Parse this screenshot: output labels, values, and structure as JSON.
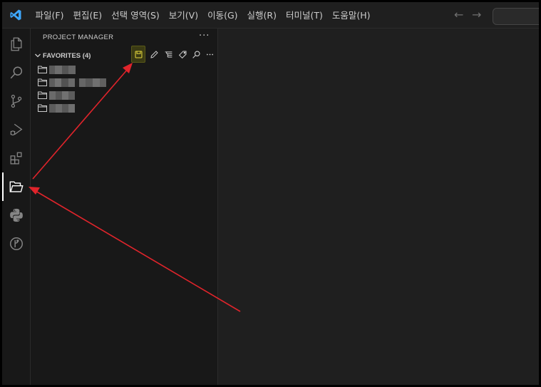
{
  "menu": {
    "items": [
      "파일(F)",
      "편집(E)",
      "선택 영역(S)",
      "보기(V)",
      "이동(G)",
      "실행(R)",
      "터미널(T)",
      "도움말(H)"
    ]
  },
  "activity_bar": {
    "items": [
      "explorer-icon",
      "search-icon",
      "source-control-icon",
      "run-debug-icon",
      "extensions-icon",
      "project-manager-icon",
      "python-icon",
      "gitlens-icon"
    ],
    "active": "project-manager-icon"
  },
  "sidebar": {
    "title": "PROJECT MANAGER",
    "more_label": "···",
    "section": {
      "title": "FAVORITES",
      "count": "(4)",
      "toolbar": [
        "save-project-icon",
        "edit-projects-icon",
        "filter-icon",
        "tag-icon",
        "search-icon",
        "more-actions-icon"
      ],
      "highlighted": "save-project-icon"
    },
    "favorites_count": 4
  },
  "colors": {
    "background": "#1f1f1f",
    "sidebar": "#181818",
    "text": "#cccccc",
    "highlight": "#e2d43d",
    "annotation_arrow": "#e0242b",
    "vscode_blue": "#3ea8ff"
  }
}
